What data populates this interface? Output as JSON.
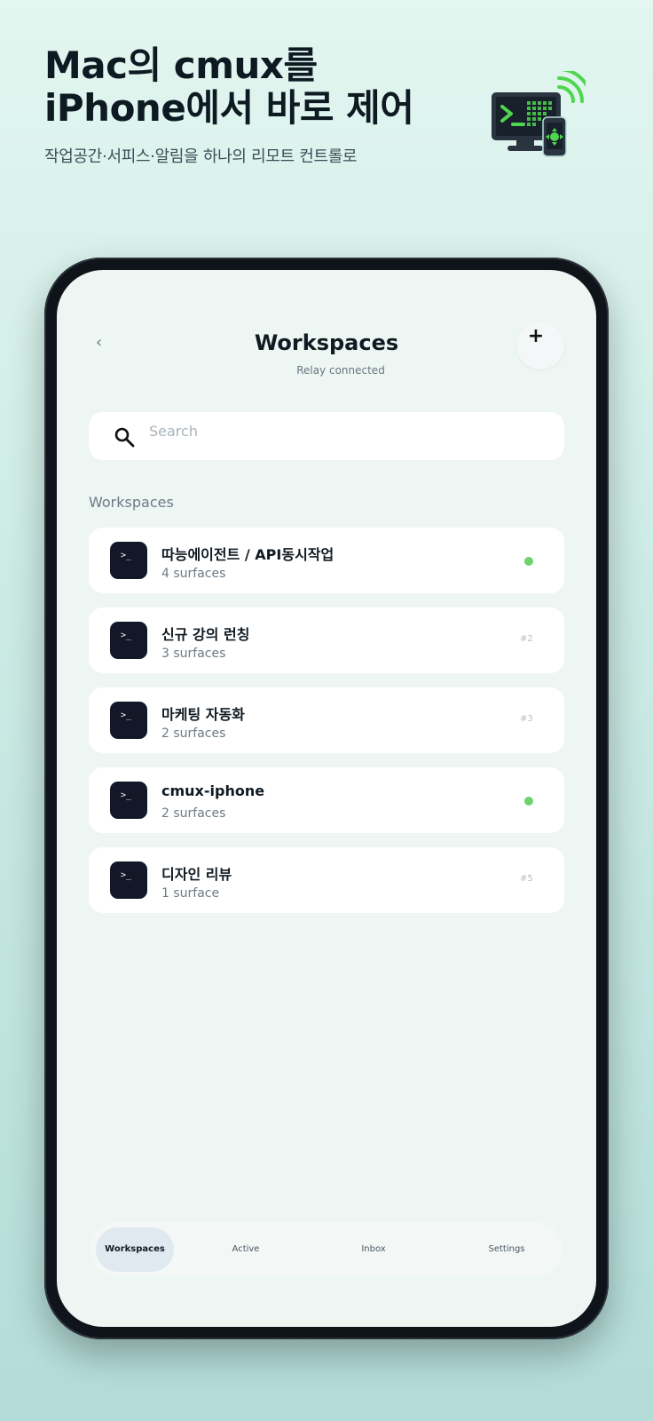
{
  "promo": {
    "title_line1": "Mac의 cmux를",
    "title_line2": "iPhone에서 바로 제어",
    "subtitle": "작업공간·서피스·알림을 하나의 리모트 컨트롤로"
  },
  "nav": {
    "back_glyph": "‹",
    "title": "Workspaces",
    "subtitle": "Relay connected",
    "add_glyph": "+"
  },
  "search": {
    "placeholder": "Search",
    "value": ""
  },
  "section": {
    "label": "Workspaces"
  },
  "workspaces": [
    {
      "icon_text": ">_",
      "title": "따능에이전트 / API동시작업",
      "subtitle": "4 surfaces",
      "indicator": "dot",
      "number": ""
    },
    {
      "icon_text": ">_",
      "title": "신규 강의 런칭",
      "subtitle": "3 surfaces",
      "indicator": "number",
      "number": "#2"
    },
    {
      "icon_text": ">_",
      "title": "마케팅 자동화",
      "subtitle": "2 surfaces",
      "indicator": "number",
      "number": "#3"
    },
    {
      "icon_text": ">_",
      "title": "cmux-iphone",
      "subtitle": "2 surfaces",
      "indicator": "dot",
      "number": ""
    },
    {
      "icon_text": ">_",
      "title": "디자인 리뷰",
      "subtitle": "1 surface",
      "indicator": "number",
      "number": "#5"
    }
  ],
  "tabs": [
    {
      "label": "Workspaces",
      "active": true
    },
    {
      "label": "Active",
      "active": false
    },
    {
      "label": "Inbox",
      "active": false
    },
    {
      "label": "Settings",
      "active": false
    }
  ],
  "colors": {
    "accent_green": "#6fd36f",
    "icon_dark": "#121827",
    "hero_green": "#4fd64f"
  },
  "icons": {
    "hero": "terminal-monitor-phone-icon",
    "search": "search-icon",
    "back": "chevron-left-icon",
    "add": "plus-icon",
    "row": "terminal-prompt-icon"
  }
}
